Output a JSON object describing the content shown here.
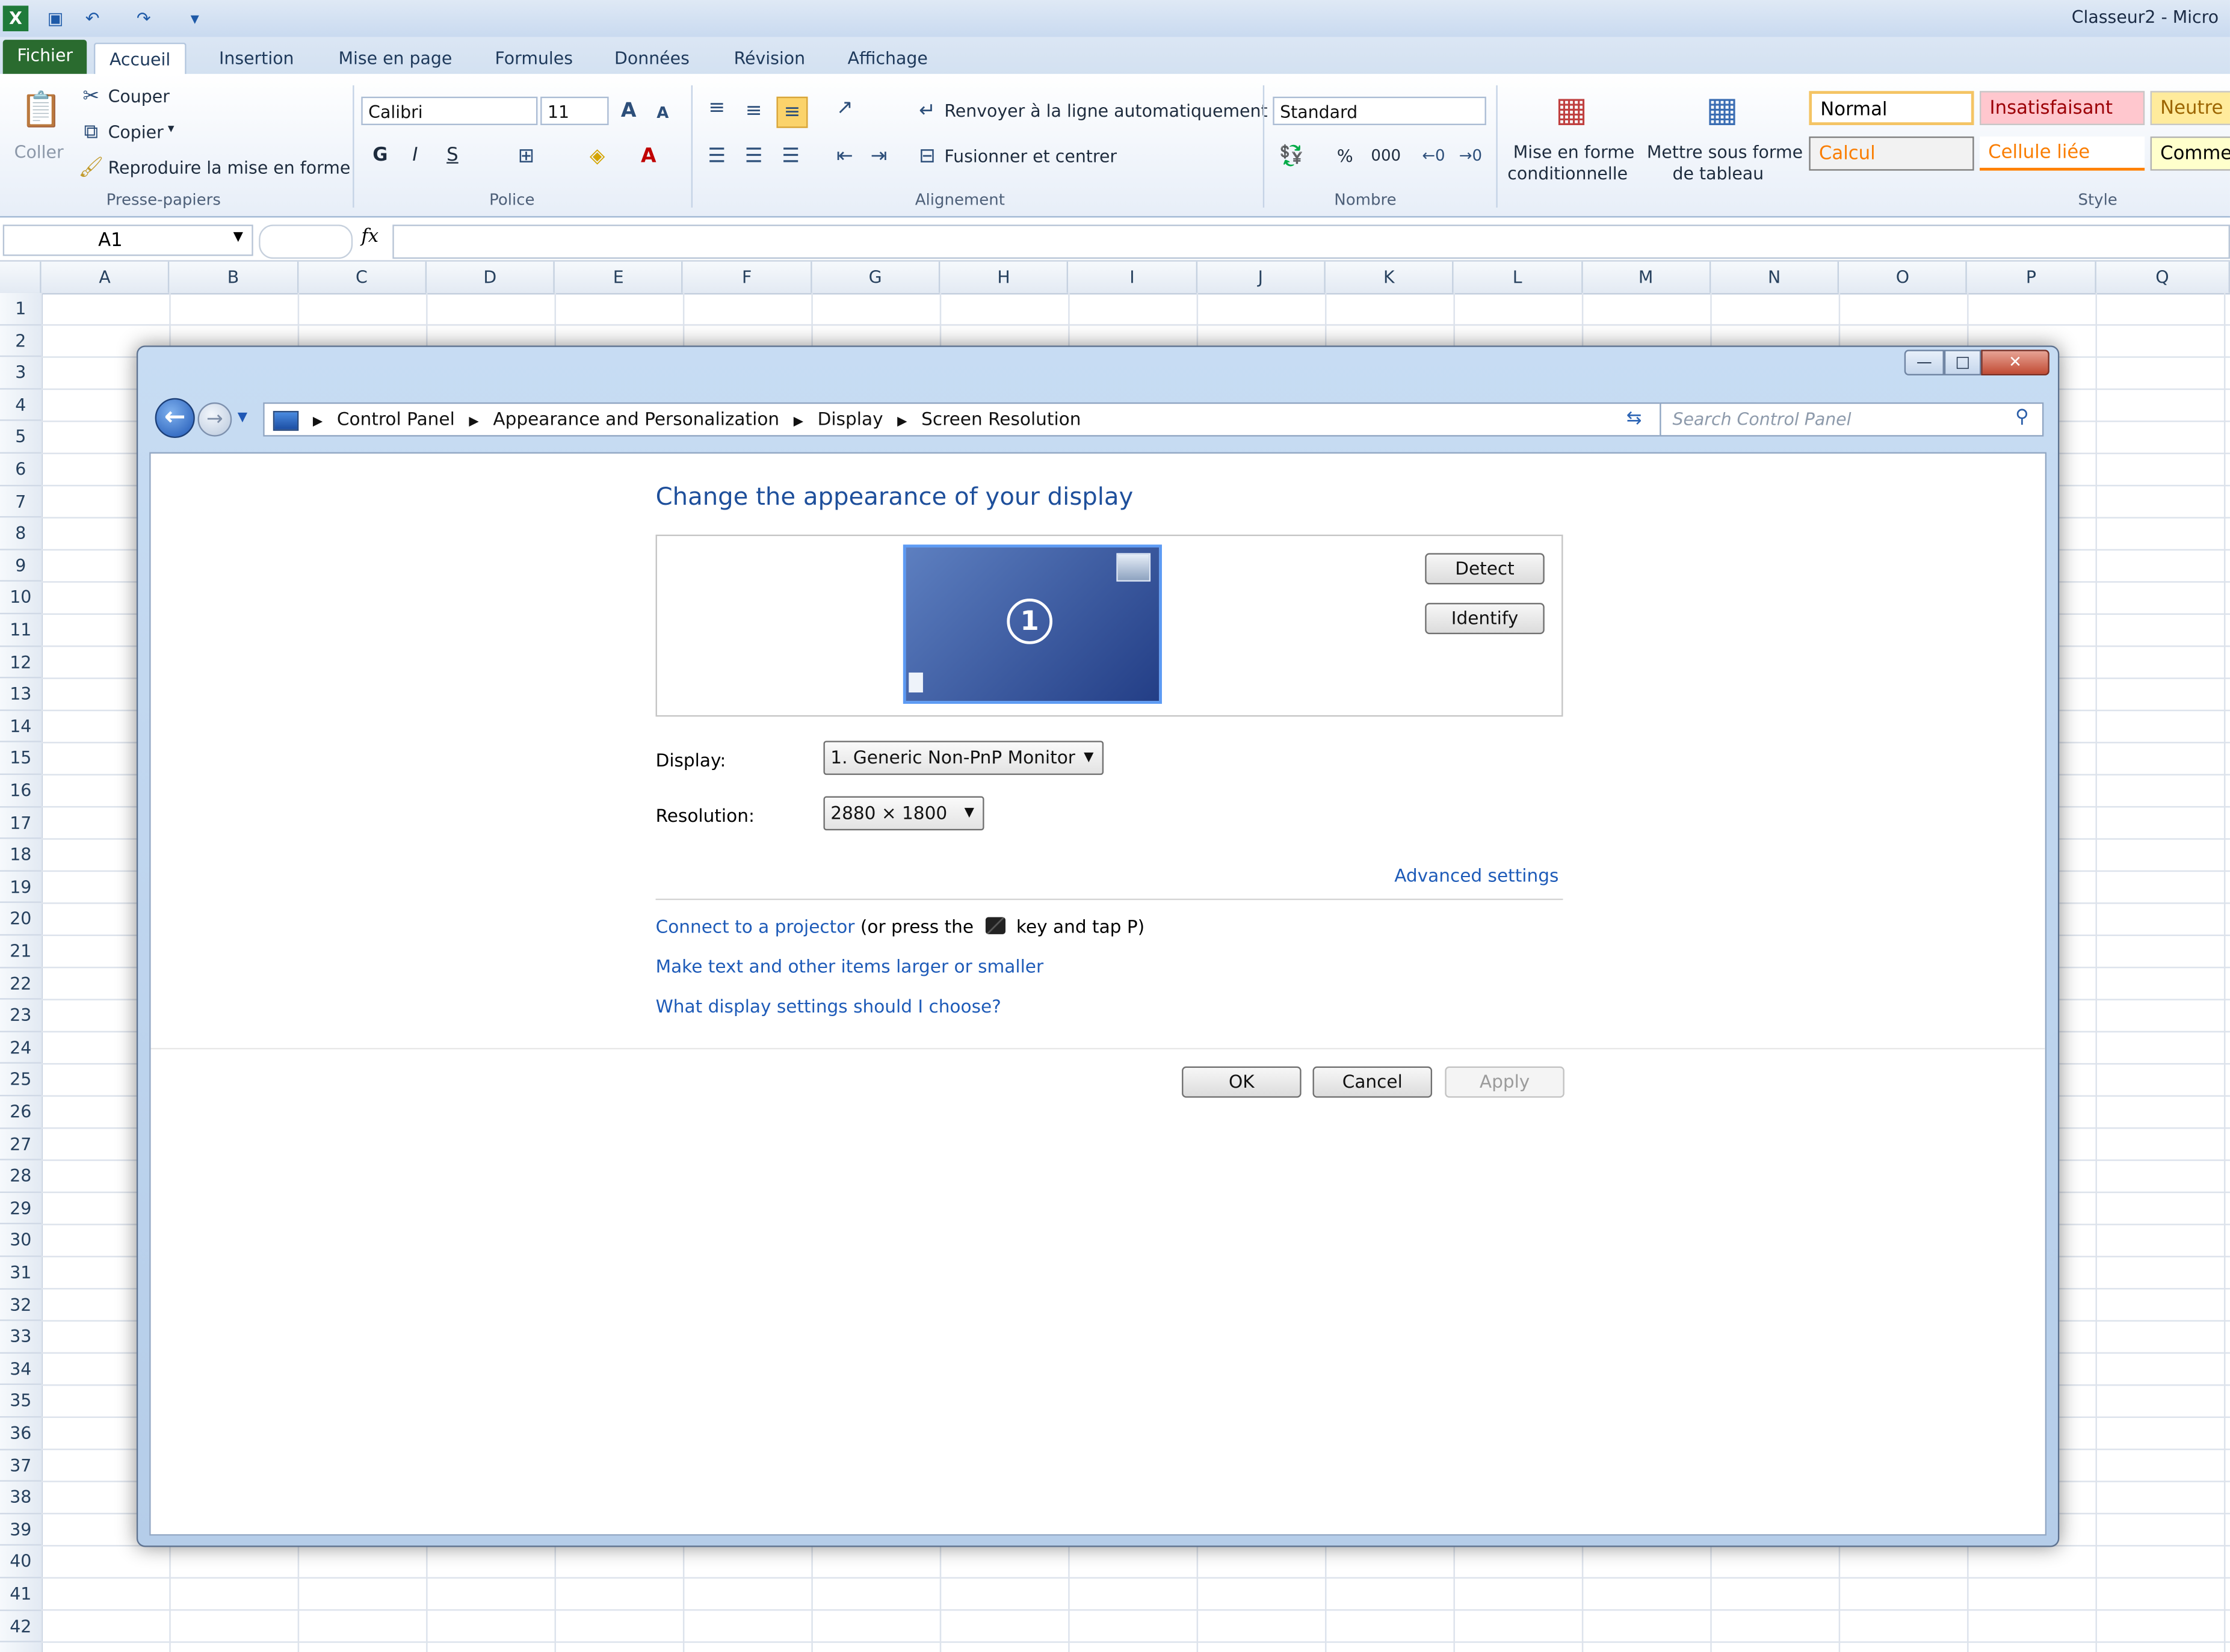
{
  "excel": {
    "title": "Classeur2 - Micro",
    "tabs": [
      "Fichier",
      "Accueil",
      "Insertion",
      "Mise en page",
      "Formules",
      "Données",
      "Révision",
      "Affichage"
    ],
    "clipboard": {
      "paste": "Coller",
      "cut": "Couper",
      "copy": "Copier",
      "format_painter": "Reproduire la mise en forme",
      "group": "Presse-papiers"
    },
    "font": {
      "name": "Calibri",
      "size": "11",
      "bold": "G",
      "italic": "I",
      "underline": "S",
      "group": "Police"
    },
    "alignment": {
      "wrap": "Renvoyer à la ligne automatiquement",
      "merge": "Fusionner et centrer",
      "group": "Alignement"
    },
    "number": {
      "format": "Standard",
      "percent": "%",
      "thousands": "000",
      "group": "Nombre"
    },
    "styles": {
      "conditional_line1": "Mise en forme",
      "conditional_line2": "conditionnelle",
      "table_line1": "Mettre sous forme",
      "table_line2": "de tableau",
      "normal": "Normal",
      "bad": "Insatisfaisant",
      "neutral": "Neutre",
      "calc": "Calcul",
      "linked": "Cellule liée",
      "comment": "Comme",
      "group": "Style"
    },
    "name_box": "A1",
    "fx": "fx",
    "columns": [
      "A",
      "B",
      "C",
      "D",
      "E",
      "F",
      "G",
      "H",
      "I",
      "J",
      "K",
      "L",
      "M",
      "N",
      "O",
      "P",
      "Q"
    ],
    "rows": [
      "1",
      "2",
      "3",
      "4",
      "5",
      "6",
      "7",
      "8",
      "9",
      "10",
      "11",
      "12",
      "13",
      "14",
      "15",
      "16",
      "17",
      "18",
      "19",
      "20",
      "21",
      "22",
      "23",
      "24",
      "25",
      "26",
      "27",
      "28",
      "29",
      "30",
      "31",
      "32",
      "33",
      "34",
      "35",
      "36",
      "37",
      "38",
      "39",
      "40",
      "41",
      "42"
    ]
  },
  "dialog": {
    "breadcrumb": [
      "Control Panel",
      "Appearance and Personalization",
      "Display",
      "Screen Resolution"
    ],
    "search_placeholder": "Search Control Panel",
    "heading": "Change the appearance of your display",
    "monitor_number": "1",
    "detect": "Detect",
    "identify": "Identify",
    "display_label": "Display:",
    "display_value": "1. Generic Non-PnP Monitor",
    "resolution_label": "Resolution:",
    "resolution_value": "2880 × 1800",
    "advanced": "Advanced settings",
    "projector_link": "Connect to a projector",
    "projector_rest1": "(or press the",
    "projector_rest2": "key and tap P)",
    "text_size_link": "Make text and other items larger or smaller",
    "help_link": "What display settings should I choose?",
    "ok": "OK",
    "cancel": "Cancel",
    "apply": "Apply"
  }
}
